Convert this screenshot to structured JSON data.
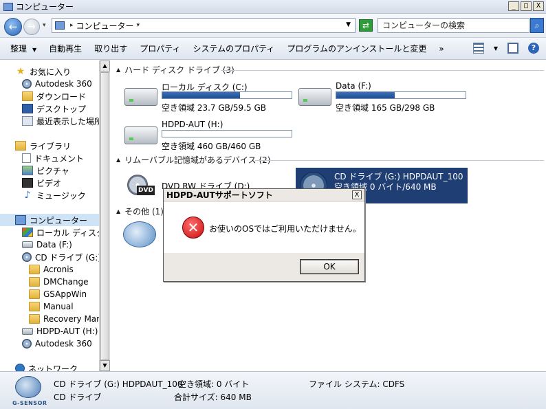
{
  "window": {
    "title": "コンピューター",
    "controls": [
      "_",
      "□",
      "X"
    ]
  },
  "address_bar": {
    "crumb": "コンピューター",
    "search_placeholder": "コンピューターの検索"
  },
  "toolbar": {
    "organize": "整理",
    "autoplay": "自動再生",
    "eject": "取り出す",
    "properties": "プロパティ",
    "system_properties": "システムのプロパティ",
    "uninstall": "プログラムのアンインストールと変更",
    "more": "»"
  },
  "nav_pane": {
    "favorites": "お気に入り",
    "autodesk360": "Autodesk 360",
    "downloads": "ダウンロード",
    "desktop": "デスクトップ",
    "recent": "最近表示した場所",
    "libraries": "ライブラリ",
    "documents": "ドキュメント",
    "pictures": "ピクチャ",
    "videos": "ビデオ",
    "music": "ミュージック",
    "computer": "コンピューター",
    "local_disk": "ローカル ディスク (C",
    "data_f": "Data (F:)",
    "cd_drive": "CD ドライブ (G:) H",
    "acronis": "Acronis",
    "dmchange": "DMChange",
    "gsappwin": "GSAppWin",
    "manual": "Manual",
    "recovery": "Recovery Manag",
    "hdpd_aut": "HDPD-AUT (H:)",
    "autodesk360_b": "Autodesk 360",
    "network": "ネットワーク"
  },
  "content": {
    "hdd_header": "ハード ディスク ドライブ (3)",
    "removable_header": "リムーバブル記憶域があるデバイス (2)",
    "other_header": "その他 (1)",
    "drives": [
      {
        "name": "ローカル ディスク (C:)",
        "free": "空き領域 23.7 GB/59.5 GB",
        "used_fraction": 0.6
      },
      {
        "name": "Data (F:)",
        "free": "空き領域 165 GB/298 GB",
        "used_fraction": 0.45
      },
      {
        "name": "HDPD-AUT (H:)",
        "free": "空き領域 460 GB/460 GB",
        "used_fraction": 0.0
      }
    ],
    "dvd_name": "DVD RW ドライブ (D:)",
    "dvd_badge": "DVD",
    "cd_name": "CD ドライブ (G:) HDPDAUT_100",
    "cd_free": "空き領域 0 バイト/640 MB"
  },
  "dialog": {
    "title": "HDPD-AUTサポートソフト",
    "message": "お使いのOSではご利用いただけません。",
    "ok": "OK"
  },
  "details": {
    "logo_text": "G-SENSOR",
    "name": "CD ドライブ (G:) HDPDAUT_100",
    "type": "CD ドライブ",
    "free": "空き領域: 0 バイト",
    "total": "合計サイズ: 640 MB",
    "filesystem": "ファイル システム: CDFS"
  }
}
